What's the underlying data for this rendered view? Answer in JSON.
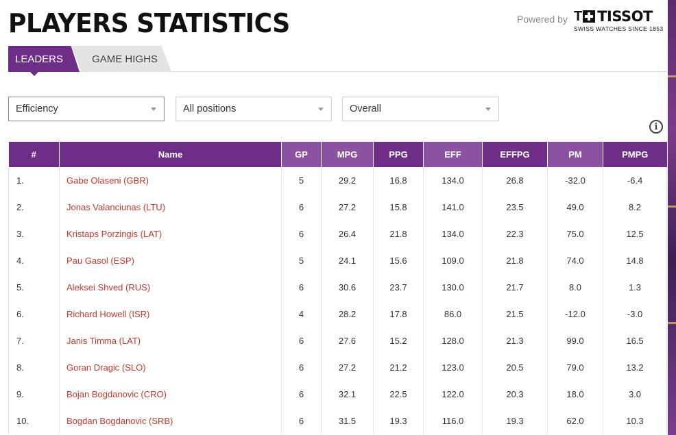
{
  "page": {
    "title": "PLAYERS STATISTICS",
    "powered_by": "Powered by",
    "sponsor": {
      "word": "TISSOT",
      "t_letter": "T",
      "tagline": "SWISS WATCHES SINCE 1853"
    }
  },
  "tabs": [
    {
      "label": "LEADERS",
      "active": true
    },
    {
      "label": "GAME HIGHS",
      "active": false
    }
  ],
  "filters": {
    "stat": "Efficiency",
    "position": "All positions",
    "phase": "Overall"
  },
  "info_icon": "i",
  "colors": {
    "accent": "#6e2d87",
    "accent_alt": "#8a52a0",
    "link": "#c0392b"
  },
  "table": {
    "headers": [
      "#",
      "Name",
      "GP",
      "MPG",
      "PPG",
      "EFF",
      "EFFPG",
      "PM",
      "PMPG"
    ],
    "rows": [
      [
        "1.",
        "Gabe Olaseni (GBR)",
        "5",
        "29.2",
        "16.8",
        "134.0",
        "26.8",
        "-32.0",
        "-6.4"
      ],
      [
        "2.",
        "Jonas Valanciunas (LTU)",
        "6",
        "27.2",
        "15.8",
        "141.0",
        "23.5",
        "49.0",
        "8.2"
      ],
      [
        "3.",
        "Kristaps Porzingis (LAT)",
        "6",
        "26.4",
        "21.8",
        "134.0",
        "22.3",
        "75.0",
        "12.5"
      ],
      [
        "4.",
        "Pau Gasol (ESP)",
        "5",
        "24.1",
        "15.6",
        "109.0",
        "21.8",
        "74.0",
        "14.8"
      ],
      [
        "5.",
        "Aleksei Shved (RUS)",
        "6",
        "30.6",
        "23.7",
        "130.0",
        "21.7",
        "8.0",
        "1.3"
      ],
      [
        "6.",
        "Richard Howell (ISR)",
        "4",
        "28.2",
        "17.8",
        "86.0",
        "21.5",
        "-12.0",
        "-3.0"
      ],
      [
        "7.",
        "Janis Timma (LAT)",
        "6",
        "27.6",
        "15.2",
        "128.0",
        "21.3",
        "99.0",
        "16.5"
      ],
      [
        "8.",
        "Goran Dragic (SLO)",
        "6",
        "27.2",
        "21.2",
        "123.0",
        "20.5",
        "79.0",
        "13.2"
      ],
      [
        "9.",
        "Bojan Bogdanovic (CRO)",
        "6",
        "32.1",
        "22.5",
        "122.0",
        "20.3",
        "18.0",
        "3.0"
      ],
      [
        "10.",
        "Bogdan Bogdanovic (SRB)",
        "6",
        "31.5",
        "19.3",
        "116.0",
        "19.3",
        "62.0",
        "10.3"
      ]
    ]
  }
}
